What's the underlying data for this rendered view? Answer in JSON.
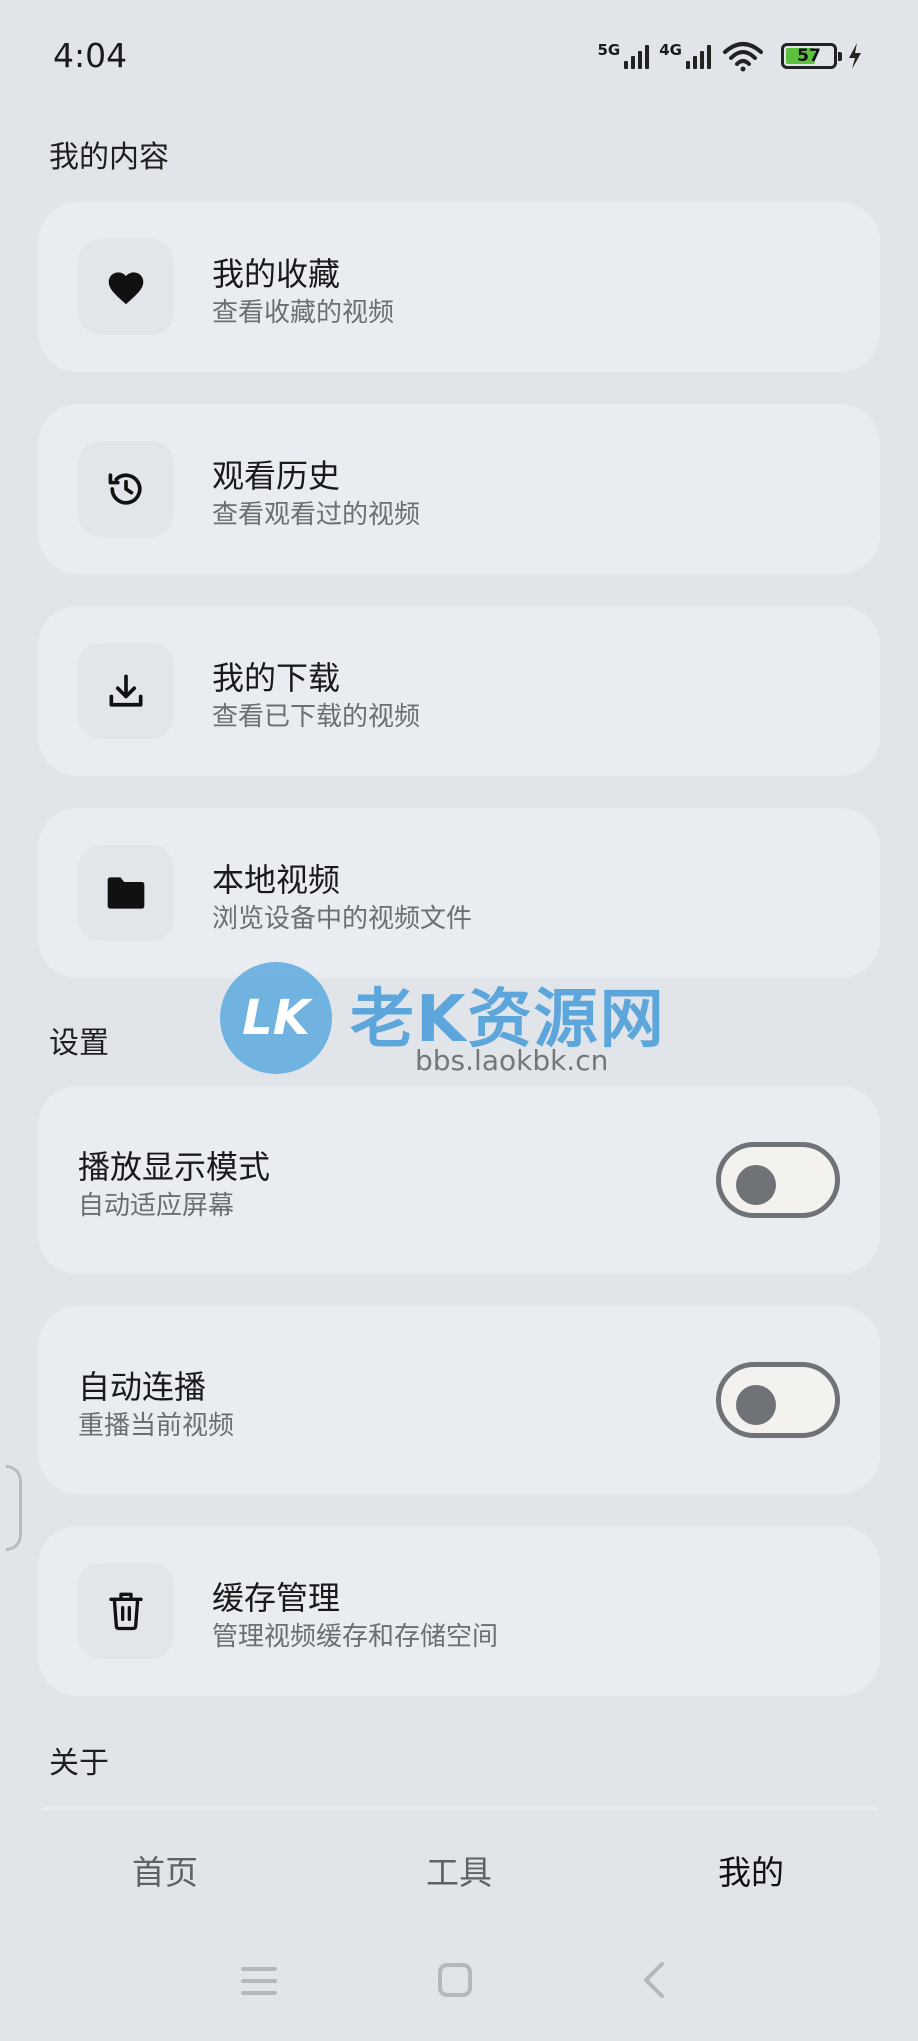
{
  "status_bar": {
    "time": "4:04",
    "network1": "5G",
    "network2": "4G",
    "battery": "57",
    "battery_color": "#5cc13c"
  },
  "sections": {
    "my_content": "我的内容",
    "settings": "设置",
    "about": "关于"
  },
  "content_items": [
    {
      "title": "我的收藏",
      "subtitle": "查看收藏的视频",
      "icon": "heart-icon"
    },
    {
      "title": "观看历史",
      "subtitle": "查看观看过的视频",
      "icon": "history-icon"
    },
    {
      "title": "我的下载",
      "subtitle": "查看已下载的视频",
      "icon": "download-icon"
    },
    {
      "title": "本地视频",
      "subtitle": "浏览设备中的视频文件",
      "icon": "folder-icon"
    }
  ],
  "settings_items": [
    {
      "title": "播放显示模式",
      "subtitle": "自动适应屏幕",
      "toggle_on": false
    },
    {
      "title": "自动连播",
      "subtitle": "重播当前视频",
      "toggle_on": false
    },
    {
      "title": "缓存管理",
      "subtitle": "管理视频缓存和存储空间",
      "icon": "trash-icon"
    }
  ],
  "bottom_nav": [
    {
      "label": "首页",
      "active": false
    },
    {
      "label": "工具",
      "active": false
    },
    {
      "label": "我的",
      "active": true
    }
  ],
  "watermark": {
    "logo_text": "LK",
    "title": "老K资源网",
    "url": "bbs.laokbk.cn"
  }
}
